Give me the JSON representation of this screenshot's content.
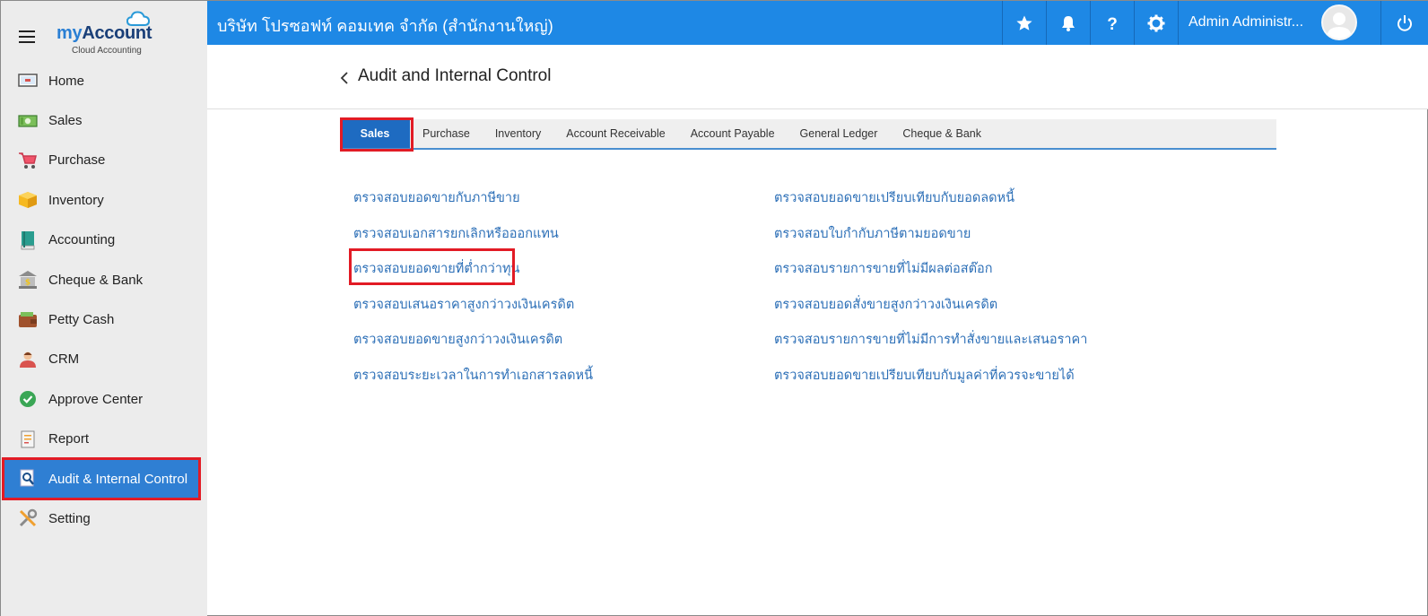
{
  "app": {
    "logo_main_a": "my",
    "logo_main_b": "Account",
    "logo_sub": "Cloud Accounting",
    "brand_color": "#1e88e5"
  },
  "topbar": {
    "company": "บริษัท โปรซอฟท์ คอมเทค จำกัด (สำนักงานใหญ่)",
    "user_name": "Admin Administr...",
    "icons": [
      "star-icon",
      "bell-icon",
      "help-icon",
      "gear-icon",
      "power-icon"
    ]
  },
  "sidebar": {
    "items": [
      {
        "label": "Home",
        "icon": "home-icon"
      },
      {
        "label": "Sales",
        "icon": "money-icon"
      },
      {
        "label": "Purchase",
        "icon": "cart-icon"
      },
      {
        "label": "Inventory",
        "icon": "box-icon"
      },
      {
        "label": "Accounting",
        "icon": "book-icon"
      },
      {
        "label": "Cheque & Bank",
        "icon": "bank-icon"
      },
      {
        "label": "Petty Cash",
        "icon": "wallet-icon"
      },
      {
        "label": "CRM",
        "icon": "people-icon"
      },
      {
        "label": "Approve Center",
        "icon": "check-circle-icon"
      },
      {
        "label": "Report",
        "icon": "report-icon"
      },
      {
        "label": "Audit & Internal Control",
        "icon": "audit-icon",
        "active": true
      },
      {
        "label": "Setting",
        "icon": "tools-icon"
      }
    ]
  },
  "page": {
    "title": "Audit and Internal Control"
  },
  "tabs": [
    {
      "label": "Sales",
      "active": true
    },
    {
      "label": "Purchase"
    },
    {
      "label": "Inventory"
    },
    {
      "label": "Account Receivable"
    },
    {
      "label": "Account Payable"
    },
    {
      "label": "General Ledger"
    },
    {
      "label": "Cheque & Bank"
    }
  ],
  "links": {
    "left": [
      "ตรวจสอบยอดขายกับภาษีขาย",
      "ตรวจสอบเอกสารยกเลิกหรือออกแทน",
      "ตรวจสอบยอดขายที่ต่ำกว่าทุน",
      "ตรวจสอบเสนอราคาสูงกว่าวงเงินเครดิต",
      "ตรวจสอบยอดขายสูงกว่าวงเงินเครดิต",
      "ตรวจสอบระยะเวลาในการทำเอกสารลดหนี้"
    ],
    "right": [
      "ตรวจสอบยอดขายเปรียบเทียบกับยอดลดหนี้",
      "ตรวจสอบใบกำกับภาษีตามยอดขาย",
      "ตรวจสอบรายการขายที่ไม่มีผลต่อสต๊อก",
      "ตรวจสอบยอดสั่งขายสูงกว่าวงเงินเครดิต",
      "ตรวจสอบรายการขายที่ไม่มีการทำสั่งขายและเสนอราคา",
      "ตรวจสอบยอดขายเปรียบเทียบกับมูลค่าที่ควรจะขายได้"
    ]
  }
}
